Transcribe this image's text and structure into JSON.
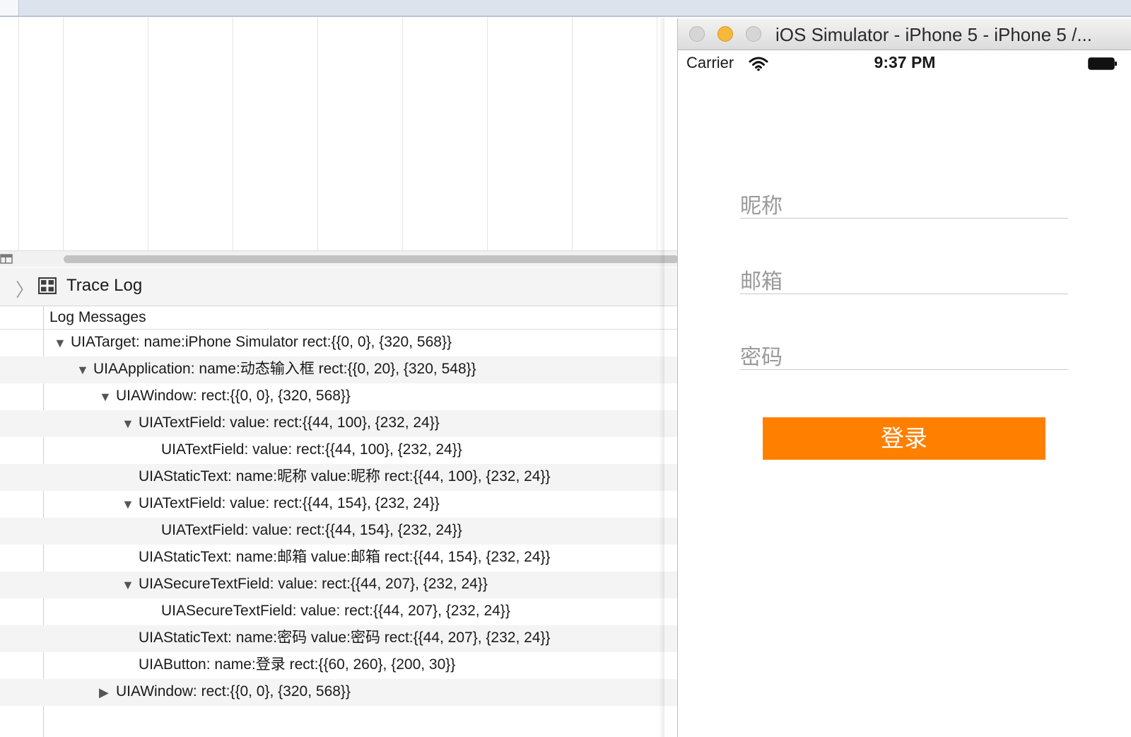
{
  "detail": {
    "title": "Trace Log",
    "column_header": "Log Messages"
  },
  "log_rows": [
    {
      "indent": 0,
      "expand": "expanded",
      "text": "UIATarget: name:iPhone Simulator rect:{{0, 0}, {320, 568}}"
    },
    {
      "indent": 1,
      "expand": "expanded",
      "text": "UIAApplication: name:动态输入框 rect:{{0, 20}, {320, 548}}"
    },
    {
      "indent": 2,
      "expand": "expanded",
      "text": "UIAWindow: rect:{{0, 0}, {320, 568}}"
    },
    {
      "indent": 3,
      "expand": "expanded",
      "text": "UIATextField: value: rect:{{44, 100}, {232, 24}}"
    },
    {
      "indent": 4,
      "expand": "none",
      "text": "UIATextField: value: rect:{{44, 100}, {232, 24}}"
    },
    {
      "indent": 3,
      "expand": "none",
      "text": "UIAStaticText: name:昵称 value:昵称 rect:{{44, 100}, {232, 24}}"
    },
    {
      "indent": 3,
      "expand": "expanded",
      "text": "UIATextField: value: rect:{{44, 154}, {232, 24}}"
    },
    {
      "indent": 4,
      "expand": "none",
      "text": "UIATextField: value: rect:{{44, 154}, {232, 24}}"
    },
    {
      "indent": 3,
      "expand": "none",
      "text": "UIAStaticText: name:邮箱 value:邮箱 rect:{{44, 154}, {232, 24}}"
    },
    {
      "indent": 3,
      "expand": "expanded",
      "text": "UIASecureTextField: value: rect:{{44, 207}, {232, 24}}"
    },
    {
      "indent": 4,
      "expand": "none",
      "text": "UIASecureTextField: value: rect:{{44, 207}, {232, 24}}"
    },
    {
      "indent": 3,
      "expand": "none",
      "text": "UIAStaticText: name:密码 value:密码 rect:{{44, 207}, {232, 24}}"
    },
    {
      "indent": 3,
      "expand": "none",
      "text": "UIAButton: name:登录 rect:{{60, 260}, {200, 30}}"
    },
    {
      "indent": 2,
      "expand": "collapsed",
      "text": "UIAWindow: rect:{{0, 0}, {320, 568}}"
    }
  ],
  "simulator": {
    "window_title": "iOS Simulator - iPhone 5 - iPhone 5 /...",
    "status": {
      "carrier": "Carrier",
      "time": "9:37 PM"
    },
    "fields": {
      "nickname_placeholder": "昵称",
      "email_placeholder": "邮箱",
      "password_placeholder": "密码"
    },
    "login_button": "登录",
    "accent_color": "#ff8000"
  }
}
